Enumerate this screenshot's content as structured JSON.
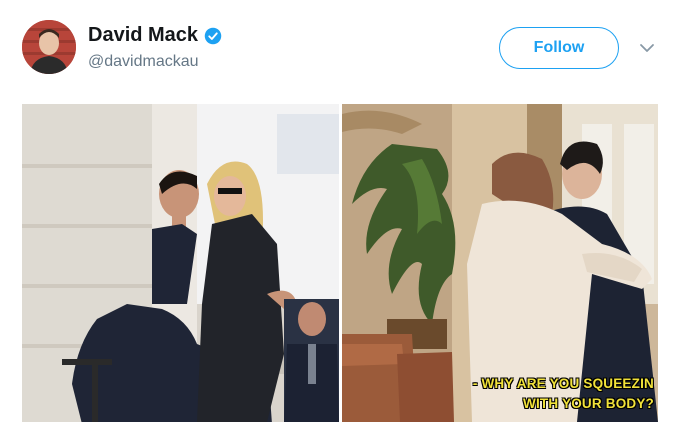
{
  "tweet": {
    "author": {
      "display_name": "David Mack",
      "handle": "@davidmackau",
      "verified": true,
      "verified_icon": "verified-badge-icon"
    },
    "follow_label": "Follow",
    "menu_icon": "chevron-down-icon"
  },
  "media": {
    "left_photo": "photo",
    "right_photo": {
      "subtitle_line_1": "- WHY ARE YOU SQUEEZIN",
      "subtitle_line_2": "WITH YOUR BODY?"
    }
  },
  "colors": {
    "accent": "#1da1f2",
    "subtitle": "#f1e23a",
    "name": "#14171a",
    "handle": "#657786"
  }
}
